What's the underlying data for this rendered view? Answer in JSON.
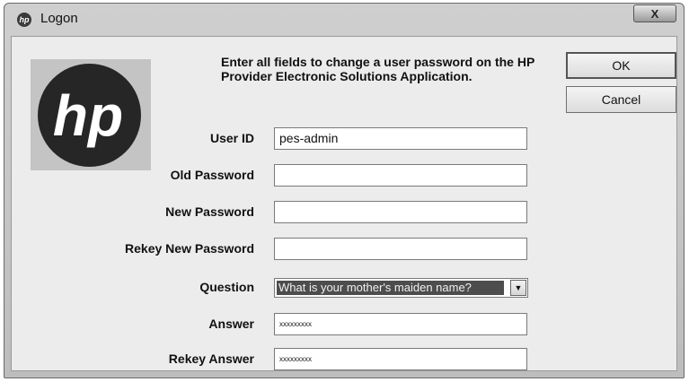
{
  "window": {
    "title": "Logon",
    "close_glyph": "X"
  },
  "logo": {
    "text": "hp"
  },
  "instructions": "Enter all fields to change a user password on the HP Provider Electronic Solutions Application.",
  "buttons": {
    "ok": "OK",
    "cancel": "Cancel"
  },
  "form": {
    "user_id": {
      "label": "User ID",
      "value": "pes-admin"
    },
    "old_password": {
      "label": "Old Password",
      "value": ""
    },
    "new_password": {
      "label": "New Password",
      "value": ""
    },
    "rekey_new_password": {
      "label": "Rekey New Password",
      "value": ""
    },
    "question": {
      "label": "Question",
      "value": "What is your mother's maiden name?"
    },
    "answer": {
      "label": "Answer",
      "value": "xxxxxxxxx"
    },
    "rekey_answer": {
      "label": "Rekey Answer",
      "value": "xxxxxxxxx"
    }
  },
  "icons": {
    "title_icon": "hp-logo-icon",
    "dropdown": "chevron-down-icon",
    "close": "close-icon"
  }
}
